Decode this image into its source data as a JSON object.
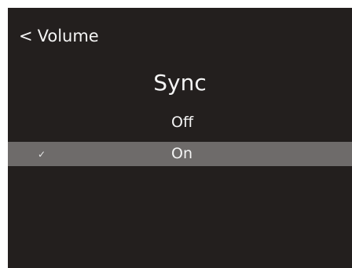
{
  "header": {
    "back_icon": "<",
    "back_label": "Volume"
  },
  "menu": {
    "title": "Sync",
    "options": [
      {
        "label": "Off",
        "selected": false
      },
      {
        "label": "On",
        "selected": true
      }
    ],
    "check_glyph": "✓"
  },
  "colors": {
    "background": "#231f1e",
    "highlight": "#6e6b6a",
    "text": "#f4f4f4"
  }
}
